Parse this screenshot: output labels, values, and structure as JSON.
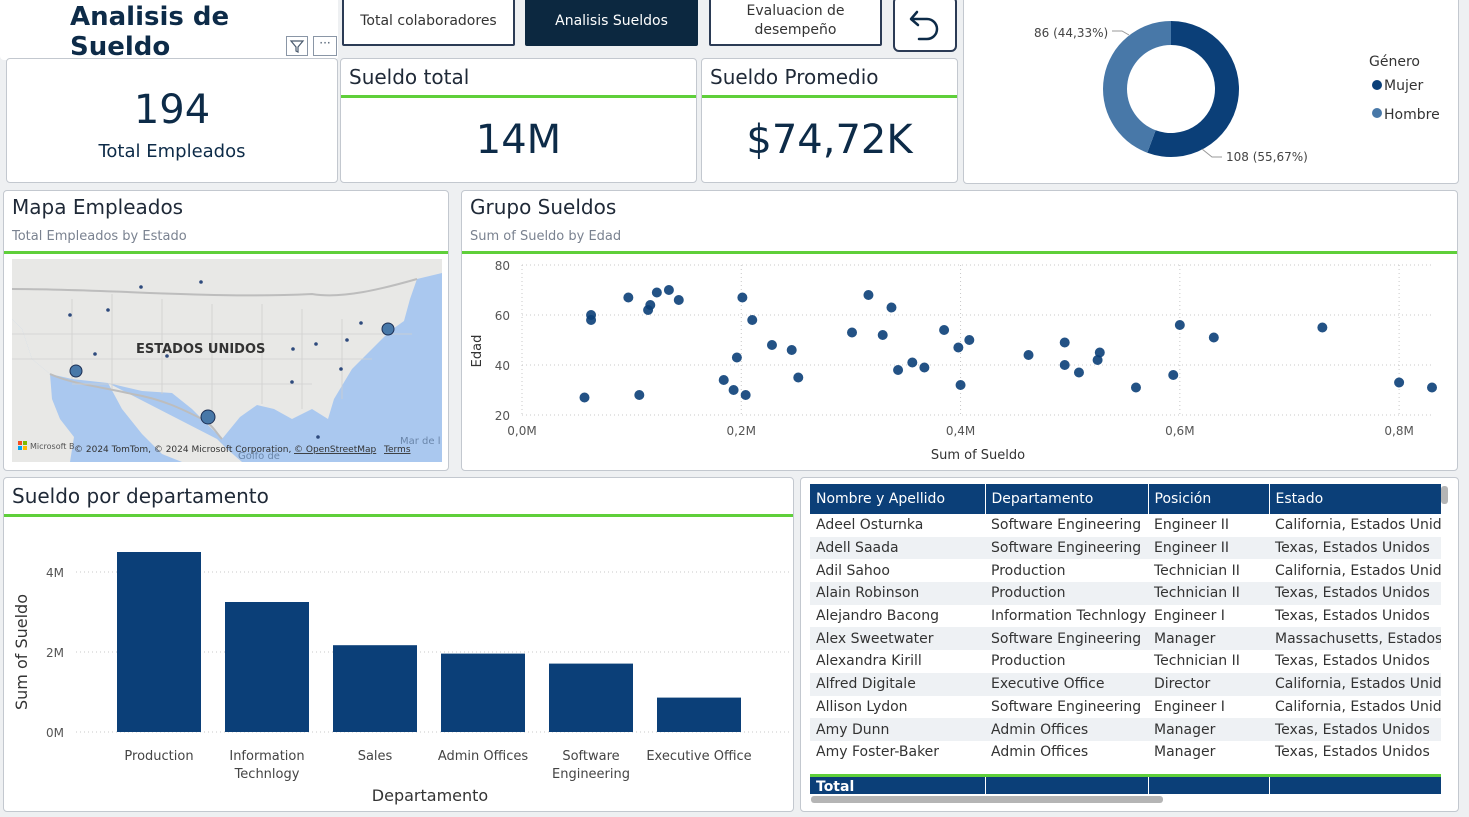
{
  "header": {
    "title": "Analisis de Sueldo"
  },
  "nav": {
    "total_colaboradores": "Total colaboradores",
    "analisis_sueldos": "Analisis Sueldos",
    "evaluacion_line1": "Evaluacion de",
    "evaluacion_line2": "desempeño"
  },
  "kpis": {
    "total_empleados": {
      "value": "194",
      "label": "Total Empleados"
    },
    "sueldo_total": {
      "title": "Sueldo total",
      "value": "14M"
    },
    "sueldo_promedio": {
      "title": "Sueldo Promedio",
      "value": "$74,72K"
    }
  },
  "colors": {
    "accent_green": "#5fcf3a",
    "dark_blue": "#0b3f78",
    "light_blue": "#4878a8",
    "nav_dark": "#0c2840"
  },
  "donut": {
    "legend_title": "Género",
    "mujer_label": "Mujer",
    "hombre_label": "Hombre",
    "mujer_slice": "108 (55,67%)",
    "hombre_slice": "86 (44,33%)",
    "chart_data": {
      "type": "pie",
      "categories": [
        "Mujer",
        "Hombre"
      ],
      "values": [
        108,
        86
      ]
    }
  },
  "map": {
    "title": "Mapa Empleados",
    "subtitle": "Total Empleados by Estado",
    "country_label": "ESTADOS UNIDOS",
    "gulf_label": "Golfo de",
    "sea_label": "Mar de l",
    "attribution": "© 2024 TomTom, © 2024 Microsoft Corporation,",
    "osm_link": "© OpenStreetMap",
    "terms_link": "Terms",
    "ms_label": "Microsoft B"
  },
  "scatter": {
    "title": "Grupo Sueldos",
    "subtitle": "Sum of Sueldo by Edad",
    "chart_data": {
      "type": "scatter",
      "xlabel": "Sum of Sueldo",
      "ylabel": "Edad",
      "xlim": [
        0,
        0.83
      ],
      "ylim": [
        20,
        80
      ],
      "xticks": [
        "0,0M",
        "0,2M",
        "0,4M",
        "0,6M",
        "0,8M"
      ],
      "yticks": [
        "20",
        "40",
        "60",
        "80"
      ],
      "x": [
        0.057,
        0.063,
        0.063,
        0.097,
        0.107,
        0.115,
        0.117,
        0.123,
        0.134,
        0.143,
        0.184,
        0.193,
        0.196,
        0.201,
        0.204,
        0.21,
        0.228,
        0.246,
        0.252,
        0.301,
        0.316,
        0.329,
        0.337,
        0.343,
        0.356,
        0.367,
        0.385,
        0.398,
        0.4,
        0.408,
        0.462,
        0.495,
        0.495,
        0.508,
        0.525,
        0.527,
        0.56,
        0.594,
        0.6,
        0.631,
        0.73,
        0.8,
        0.83
      ],
      "y": [
        27,
        60,
        58,
        67,
        28,
        62,
        64,
        69,
        70,
        66,
        34,
        30,
        43,
        67,
        28,
        58,
        48,
        46,
        35,
        53,
        68,
        52,
        63,
        38,
        41,
        39,
        54,
        47,
        32,
        50,
        44,
        40,
        49,
        37,
        42,
        45,
        31,
        36,
        56,
        51,
        55,
        33,
        31
      ]
    }
  },
  "bars": {
    "title": "Sueldo por departamento",
    "chart_data": {
      "type": "bar",
      "categories": [
        "Production",
        "Information Technlogy",
        "Sales",
        "Admin Offices",
        "Software Engineering",
        "Executive Office"
      ],
      "category_lines": [
        [
          "Production"
        ],
        [
          "Information",
          "Technlogy"
        ],
        [
          "Sales"
        ],
        [
          "Admin Offices"
        ],
        [
          "Software",
          "Engineering"
        ],
        [
          "Executive Office"
        ]
      ],
      "values": [
        4.5,
        3.25,
        2.17,
        1.96,
        1.71,
        0.86
      ],
      "xlabel": "Departamento",
      "ylabel": "Sum of Sueldo",
      "ylim": [
        0,
        4.5
      ],
      "yticks": [
        "0M",
        "2M",
        "4M"
      ]
    }
  },
  "table": {
    "columns": [
      "Nombre y Apellido",
      "Departamento",
      "Posición",
      "Estado"
    ],
    "rows": [
      [
        "Adeel Osturnka",
        "Software Engineering",
        "Engineer II",
        "California, Estados Unidos"
      ],
      [
        "Adell Saada",
        "Software Engineering",
        "Engineer II",
        "Texas, Estados Unidos"
      ],
      [
        "Adil Sahoo",
        "Production",
        "Technician II",
        "California, Estados Unidos"
      ],
      [
        "Alain Robinson",
        "Production",
        "Technician II",
        "Texas, Estados Unidos"
      ],
      [
        "Alejandro Bacong",
        "Information Technlogy",
        "Engineer I",
        "Texas, Estados Unidos"
      ],
      [
        "Alex Sweetwater",
        "Software Engineering",
        "Manager",
        "Massachusetts, Estados Unidos"
      ],
      [
        "Alexandra Kirill",
        "Production",
        "Technician II",
        "Texas, Estados Unidos"
      ],
      [
        "Alfred Digitale",
        "Executive Office",
        "Director",
        "California, Estados Unidos"
      ],
      [
        "Allison Lydon",
        "Software Engineering",
        "Engineer I",
        "California, Estados Unidos"
      ],
      [
        "Amy Dunn",
        "Admin Offices",
        "Manager",
        "Texas, Estados Unidos"
      ],
      [
        "Amy Foster-Baker",
        "Admin Offices",
        "Manager",
        "Texas, Estados Unidos"
      ]
    ],
    "total_label": "Total"
  }
}
